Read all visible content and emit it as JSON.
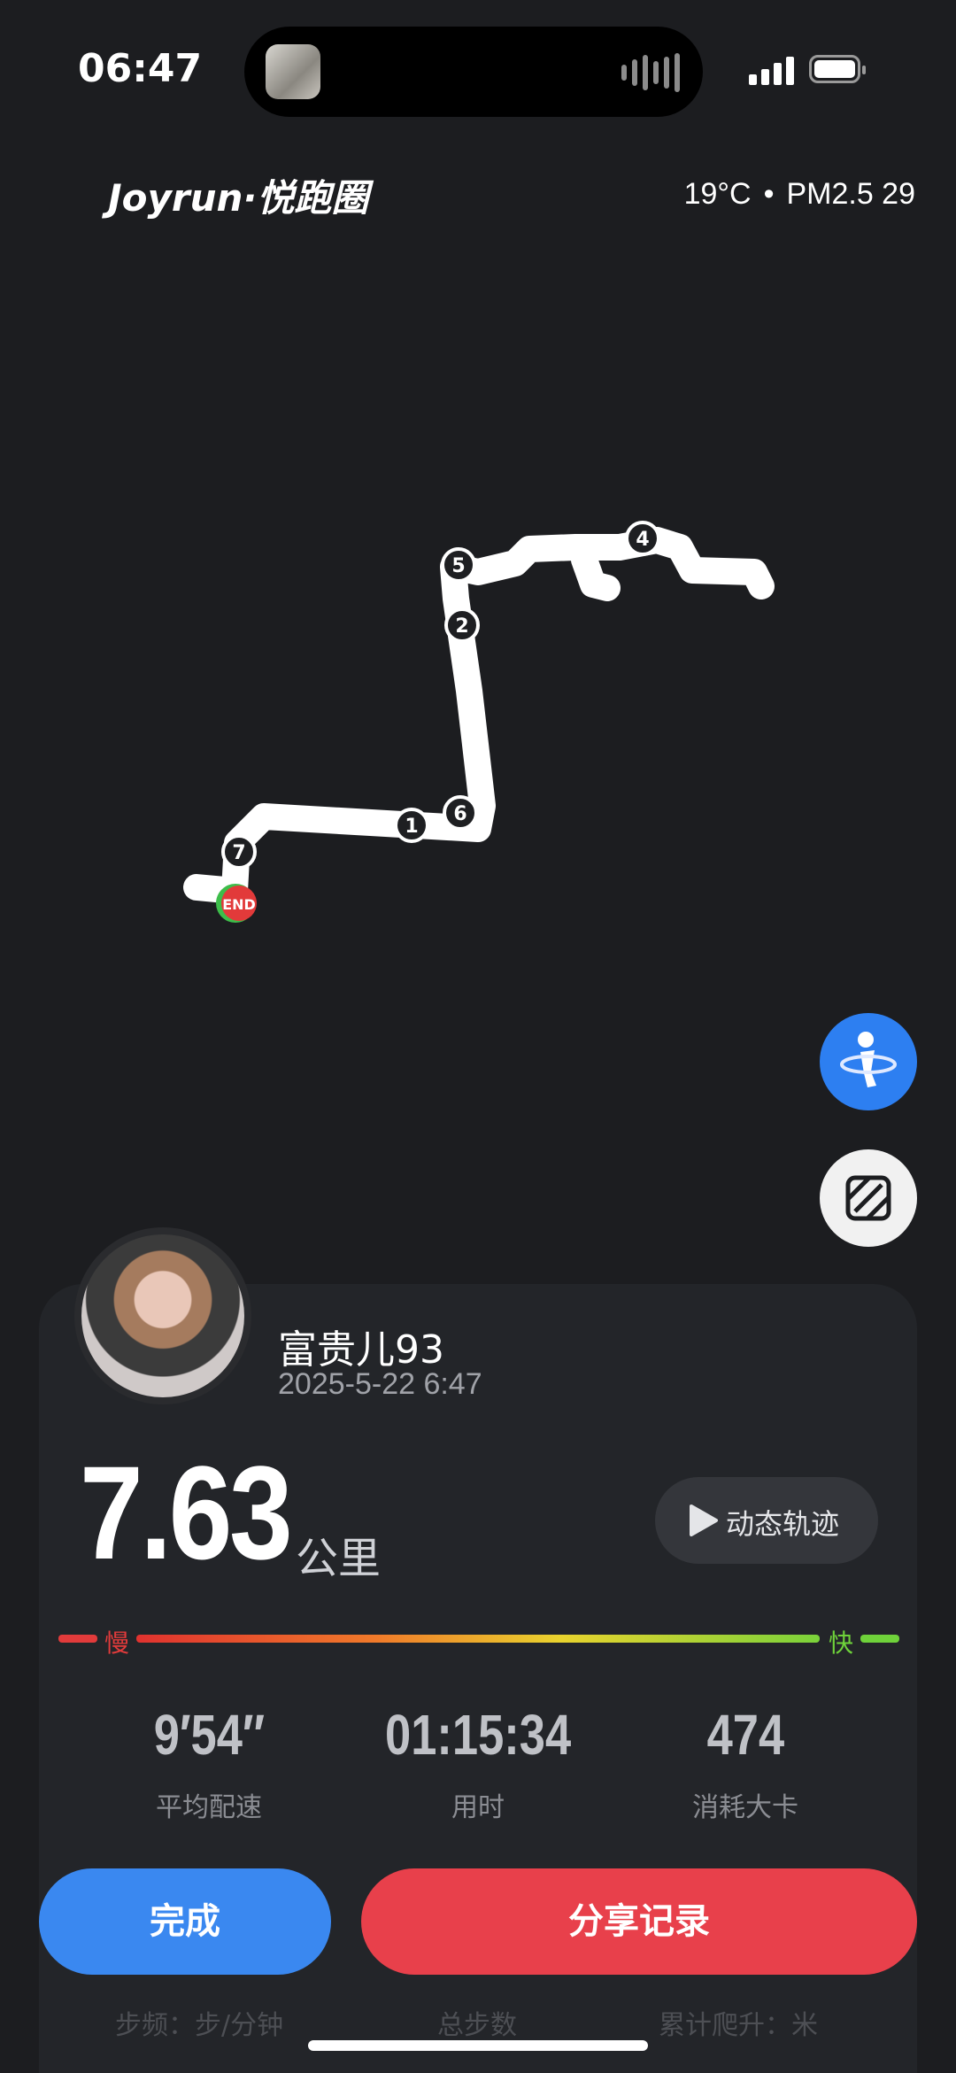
{
  "status_bar": {
    "time": "06:47"
  },
  "header": {
    "brand": "Joyrun·悦跑圈",
    "temperature": "19°C",
    "separator": "•",
    "air_quality": "PM2.5 29"
  },
  "map": {
    "markers": [
      "1",
      "2",
      "4",
      "5",
      "6",
      "7"
    ],
    "end_label": "END"
  },
  "profile": {
    "username": "富贵儿93",
    "datetime": "2025-5-22 6:47"
  },
  "run": {
    "distance": "7.63",
    "distance_unit": "公里",
    "replay_label": "动态轨迹"
  },
  "pace_scale": {
    "slow": "慢",
    "fast": "快"
  },
  "stats": [
    {
      "value": "9′54′′",
      "label": "平均配速"
    },
    {
      "value": "01:15:34",
      "label": "用时"
    },
    {
      "value": "474",
      "label": "消耗大卡"
    }
  ],
  "stats_row2": {
    "cadence": "步频：步/分钟",
    "steps": "总步数",
    "climb": "累计爬升：米"
  },
  "actions": {
    "done": "完成",
    "share": "分享记录"
  },
  "colors": {
    "background": "#1c1d20",
    "card": "#232529",
    "primary_blue": "#3a88f0",
    "share_red": "#e8404b",
    "slow_red": "#e23b3b",
    "fast_green": "#6fd23a"
  }
}
